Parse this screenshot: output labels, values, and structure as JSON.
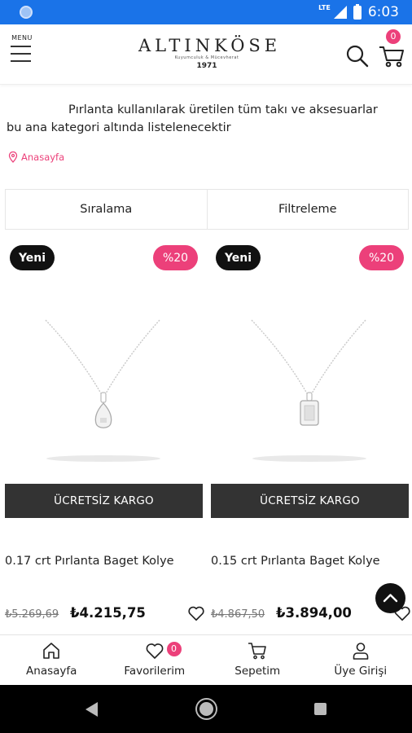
{
  "status_bar": {
    "network": "LTE",
    "time": "6:03"
  },
  "header": {
    "menu_label": "MENU",
    "logo_text": "ALTINKÖSE",
    "logo_tagline": "Kuyumculuk & Mücevherat",
    "logo_year": "1971",
    "cart_count": "0",
    "icons": {
      "menu": "hamburger-icon",
      "search": "search-icon",
      "cart": "cart-icon"
    }
  },
  "category": {
    "description_line1": "Pırlanta kullanılarak üretilen tüm takı ve aksesuarlar",
    "description_line2": "bu ana kategori altında listelenecektir",
    "breadcrumb": "Anasayfa"
  },
  "toolbar": {
    "sort_label": "Sıralama",
    "filter_label": "Filtreleme"
  },
  "products": [
    {
      "badge_new": "Yeni",
      "badge_discount": "%20",
      "cargo_label": "ÜCRETSİZ KARGO",
      "name": "0.17 crt Pırlanta Baget Kolye",
      "old_price": "₺5.269,69",
      "price": "₺4.215,75"
    },
    {
      "badge_new": "Yeni",
      "badge_discount": "%20",
      "cargo_label": "ÜCRETSİZ KARGO",
      "name": "0.15 crt Pırlanta Baget Kolye",
      "old_price": "₺4.867,50",
      "price": "₺3.894,00"
    }
  ],
  "bottom_nav": {
    "items": [
      {
        "label": "Anasayfa",
        "icon": "home-icon"
      },
      {
        "label": "Favorilerim",
        "icon": "heart-icon"
      },
      {
        "label": "Sepetim",
        "icon": "cart-icon"
      },
      {
        "label": "Üye Girişi",
        "icon": "user-icon"
      }
    ],
    "favorites_count": "0"
  },
  "colors": {
    "accent": "#ec407a",
    "status_bar": "#1a73e8",
    "cargo_bg": "#333333"
  }
}
